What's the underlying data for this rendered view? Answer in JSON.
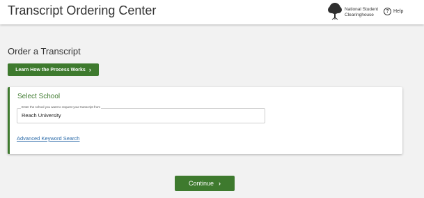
{
  "header": {
    "title": "Transcript Ordering Center",
    "logo_text_line1": "National Student",
    "logo_text_line2": "Clearinghouse",
    "help_label": "Help"
  },
  "main": {
    "title": "Order a Transcript",
    "learn_button_label": "Learn How the Process Works"
  },
  "select_school": {
    "title": "Select School",
    "field_label": "Enter the school you want to request your transcript from",
    "field_value": "Reach University",
    "advanced_search_link": "Advanced Keyword Search"
  },
  "footer": {
    "continue_label": "Continue"
  },
  "colors": {
    "accent": "#3e7a2e",
    "link": "#2a6aa8"
  },
  "icons": {
    "logo": "tree-logo-icon",
    "help": "help-circle-icon",
    "chevron": "chevron-right-icon"
  }
}
